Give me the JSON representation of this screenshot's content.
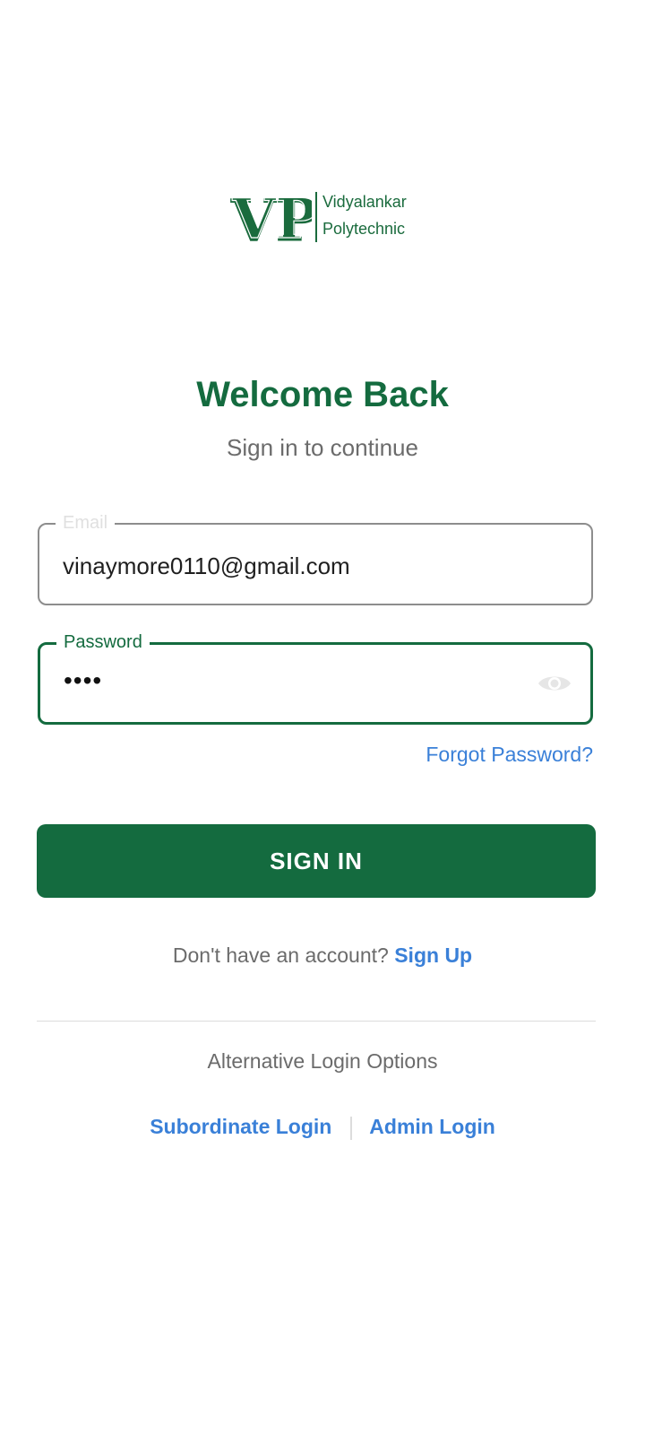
{
  "logo": {
    "line1": "Vidyalankar",
    "line2": "Polytechnic",
    "monogram": "VP",
    "brand_color": "#1a6b3d"
  },
  "header": {
    "title": "Welcome Back",
    "subtitle": "Sign in to continue"
  },
  "form": {
    "email": {
      "label": "Email",
      "value": "vinaymore0110@gmail.com"
    },
    "password": {
      "label": "Password",
      "value_masked": "••••",
      "toggle_icon": "eye-icon"
    },
    "forgot_password": "Forgot Password?",
    "signin_button": "SIGN IN"
  },
  "signup": {
    "prompt": "Don't have an account?",
    "link": "Sign Up"
  },
  "alternative": {
    "label": "Alternative Login Options",
    "subordinate": "Subordinate Login",
    "admin": "Admin Login"
  },
  "colors": {
    "primary": "#146b3f",
    "link": "#3a80d8",
    "muted_text": "#6b6b6b"
  }
}
